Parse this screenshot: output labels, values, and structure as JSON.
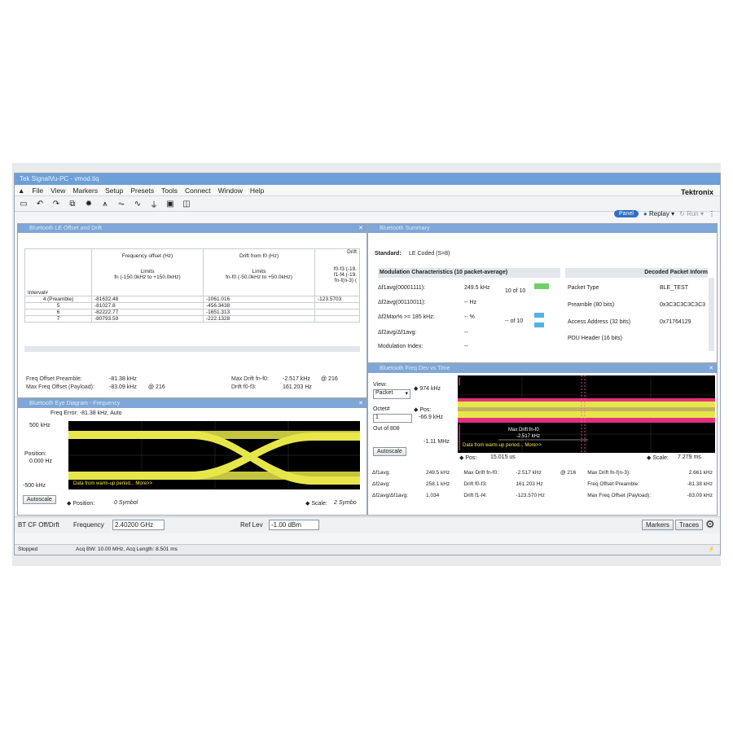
{
  "window": {
    "title": "Tek SignalVu-PC - vmod.tiq",
    "brand": "Tektronix"
  },
  "menu": [
    "File",
    "View",
    "Markers",
    "Setup",
    "Presets",
    "Tools",
    "Connect",
    "Window",
    "Help"
  ],
  "toolbar_right": {
    "panel": "Panel",
    "replay": "Replay",
    "run": "Run"
  },
  "offset_panel": {
    "title": "Bluetooth LE Offset and Drift",
    "col_freq": "Frequency offset (Hz)",
    "col_freq_limits": "Limits",
    "col_freq_range": "fn (-150.0kHz to +150.0kHz)",
    "col_drift": "Drift from f0 (Hz)",
    "col_drift_limits": "Limits",
    "col_drift_range": "fn-f0 (-50.0kHz to +50.0kHz)",
    "col_drift2": "Drift",
    "col_drift2_a": "f0-f3 (-19.",
    "col_drift2_b": "f1-f4 (-19.",
    "col_drift2_c": "fn-f(n-3) (",
    "col_interval": "Interval#",
    "rows": [
      {
        "i": "4 (Preamble)",
        "f": "-81632.48",
        "d": "-1061.016",
        "e": "-123.5703"
      },
      {
        "i": "5",
        "f": "-81027.8",
        "d": "-456.3438",
        "e": ""
      },
      {
        "i": "6",
        "f": "-82222.77",
        "d": "-1651.313",
        "e": ""
      },
      {
        "i": "7",
        "f": "-80793.59",
        "d": "-222.1328",
        "e": ""
      }
    ],
    "foot_pre_lbl": "Freq Offset Preamble:",
    "foot_pre_val": "-81.38 kHz",
    "foot_pay_lbl": "Max Freq Offset (Payload):",
    "foot_pay_val": "-83.09 kHz",
    "foot_pay_at": "@ 216",
    "foot_drift_lbl": "Max Drift fn-f0:",
    "foot_drift_val": "-2.517 kHz",
    "foot_drift_at": "@ 216",
    "foot_drift3_lbl": "Drift f0-f3:",
    "foot_drift3_val": "161.203 Hz"
  },
  "eye_panel": {
    "title": "Bluetooth Eye Diagram - Frequency",
    "freq_error": "Freq Error: -81.38 kHz, Auto",
    "ytop": "500 kHz",
    "pos_lbl": "Position:",
    "pos_val": "0.000 Hz",
    "ybot": "-500 kHz",
    "note": "Data from warm-up period... More>>",
    "autoscale": "Autoscale",
    "position": "Position:",
    "position_val": "0 Symbol",
    "scale": "Scale:",
    "scale_val": "2 Symbo"
  },
  "summary_panel": {
    "title": "Bluetooth Summary",
    "standard_lbl": "Standard:",
    "standard_val": "LE Coded (S=8)",
    "mod_title": "Modulation Characteristics (10 packet-average)",
    "mod_rows": [
      {
        "k": "Δf1avg(00001111):",
        "v": "249.5 kHz",
        "x": "10 of 10"
      },
      {
        "k": "Δf2avg(00110011):",
        "v": "-- Hz",
        "x": ""
      },
      {
        "k": "Δf2Max% >= 185 kHz:",
        "v": "-- %",
        "x": "-- of 10"
      },
      {
        "k": "Δf2avg/Δf1avg:",
        "v": "--",
        "x": ""
      },
      {
        "k": "Modulation Index:",
        "v": "--",
        "x": ""
      }
    ],
    "dec_title": "Decoded Packet Inform",
    "dec_rows": [
      {
        "k": "Packet Type",
        "v": "BLE_TEST"
      },
      {
        "k": "Preamble (80 bits)",
        "v": "0x3C3C3C3C3C3"
      },
      {
        "k": "Access Address (32 bits)",
        "v": "0x71764129"
      },
      {
        "k": "PDU Header (16 bits)",
        "v": ""
      }
    ]
  },
  "fdt_panel": {
    "title": "Bluetooth Freq Dev vs Time",
    "view_lbl": "View:",
    "view_val": "Packet",
    "octet_lbl": "Octet#",
    "octet_val": "1",
    "outof": "Out of  808",
    "ytop": "974 kHz",
    "pos_lbl": "Pos:",
    "pos_val": "-66.9 kHz",
    "ybot": "-1.11 MHz",
    "autoscale": "Autoscale",
    "marker_lbl": "Max Drift fn-f0",
    "marker_val": "-2.517 kHz",
    "note": "Data from warm-up period... More>>",
    "xpos_lbl": "Pos:",
    "xpos_val": "15.015 us",
    "xscale_lbl": "Scale:",
    "xscale_val": "7.279 ms",
    "results": [
      [
        "Δf1avg:",
        "249.5 kHz",
        "Max Drift fn-f0:",
        "-2.517 kHz",
        "@ 216",
        "Max Drift fn-f(n-3):",
        "2.661 kHz"
      ],
      [
        "Δf2avg:",
        "258.1 kHz",
        "Drift f0-f3:",
        "161.203 Hz",
        "",
        "Freq Offset Preamble:",
        "-81.38 kHz"
      ],
      [
        "Δf2avg/Δf1avg:",
        "1.034",
        "Drift f1-f4:",
        "-123.570 Hz",
        "",
        "Max Freq Offset (Payload):",
        "-83.09 kHz"
      ]
    ]
  },
  "bottom": {
    "measure": "BT CF Off/Drft",
    "freq_lbl": "Frequency",
    "freq_val": "2.40200 GHz",
    "ref_lbl": "Ref Lev",
    "ref_val": "-1.00 dBm",
    "markers": "Markers",
    "traces": "Traces"
  },
  "statusbar": {
    "state": "Stopped",
    "acq": "Acq BW: 10.00 MHz, Acq Length: 8.501 ms"
  }
}
